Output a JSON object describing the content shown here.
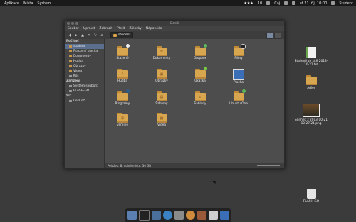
{
  "top_panel": {
    "menus": [
      "Aplikace",
      "Místa",
      "Systém"
    ],
    "rating": "★★★",
    "tray_text1": "10",
    "tray_text2": "Čaj",
    "user": "Student",
    "clock": "st 21. říj, 10:00"
  },
  "window": {
    "title": "Domů",
    "menubar": [
      "Soubor",
      "Upravit",
      "Zobrazit",
      "Přejít",
      "Záložky",
      "Nápověda"
    ],
    "path_label": "student",
    "status": "Položek: 8, volné místo: 30 GB"
  },
  "sidebar": {
    "sections": [
      {
        "header": "Počítač",
        "items": [
          {
            "label": "student",
            "selected": true
          },
          {
            "label": "Pracovní plocha",
            "selected": false
          },
          {
            "label": "Dokumenty",
            "selected": false
          },
          {
            "label": "Hudba",
            "selected": false
          },
          {
            "label": "Obrázky",
            "selected": false
          },
          {
            "label": "Videa",
            "selected": false
          },
          {
            "label": "Koš",
            "selected": false
          }
        ]
      },
      {
        "header": "Zařízení",
        "items": [
          {
            "label": "Systém souborů",
            "selected": false
          },
          {
            "label": "FLASH-GO",
            "selected": false
          }
        ]
      },
      {
        "header": "Síť",
        "items": [
          {
            "label": "Celá síť",
            "selected": false
          }
        ]
      }
    ]
  },
  "files": [
    {
      "label": "Stažené",
      "badge": "download"
    },
    {
      "label": "Dokumenty",
      "badge": ""
    },
    {
      "label": "Dropbox",
      "badge": "check"
    },
    {
      "label": "Filmy",
      "badge": "disc"
    },
    {
      "label": "Hudba",
      "badge": "monitor"
    },
    {
      "label": "Obrázky",
      "badge": ""
    },
    {
      "label": "Ukázka",
      "badge": "plus"
    },
    {
      "label": "Plocha",
      "badge": "image"
    },
    {
      "label": "Programy",
      "badge": "monitor"
    },
    {
      "label": "Šablony",
      "badge": ""
    },
    {
      "label": "Šablony",
      "badge": ""
    },
    {
      "label": "Ubuntu One",
      "badge": "check"
    },
    {
      "label": "veřejné",
      "badge": ""
    },
    {
      "label": "Videa",
      "badge": ""
    }
  ],
  "desktop": {
    "icons": [
      {
        "label": "Stažené ze sítě 2013-10-21.txt",
        "kind": "doc"
      },
      {
        "label": "Adler",
        "kind": "folder"
      },
      {
        "label": "Snímek z 2013-10-21 10:27:21.png",
        "kind": "photo"
      },
      {
        "label": "FLASH-GO",
        "kind": "usb"
      }
    ]
  },
  "dock": {
    "items": [
      "finder-icon",
      "terminal-icon",
      "files-icon",
      "browser-icon",
      "system-icon",
      "mail-icon",
      "camera-icon",
      "trash-icon",
      "gallery-icon"
    ]
  },
  "colors": {
    "panel": "#1a1a1a",
    "desktop": "#3b3b3b",
    "folder": "#d9a650",
    "selection": "#5a6e8e"
  }
}
